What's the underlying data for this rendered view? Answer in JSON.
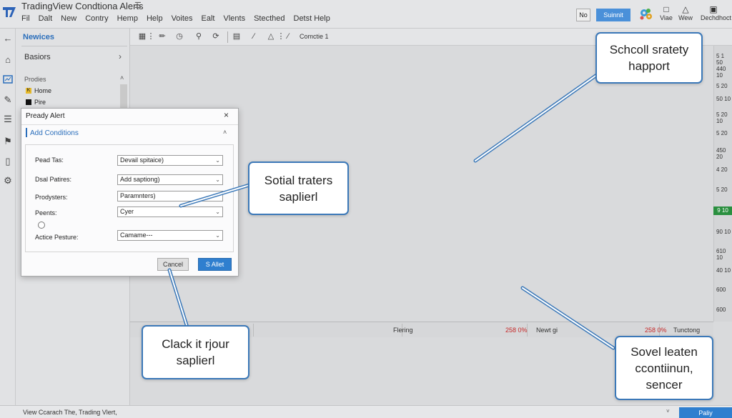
{
  "app": {
    "title": "TradingView  Condtiona Alerts",
    "title_ext": "☰",
    "menu": [
      "Fil",
      "Dalt",
      "New",
      "Contry",
      "Hemp",
      "Help",
      "Voites",
      "Ealt",
      "Vlents",
      "Stecthed",
      "Detst Help"
    ]
  },
  "top_right": {
    "no_label": "No",
    "submit_label": "Suinnit",
    "tools": [
      {
        "icon": "phone-icon",
        "label": "Viae"
      },
      {
        "icon": "bell-icon",
        "label": "Wew"
      },
      {
        "icon": "doc-icon",
        "label": "Dechdhoct"
      }
    ]
  },
  "left_toolbar": {
    "icons": [
      "back-arrow-icon",
      "home-icon",
      "chart-icon",
      "pencil-icon",
      "list-icon",
      "flag-icon",
      "page-icon",
      "settings-icon"
    ]
  },
  "panel": {
    "header": "Newices",
    "section": "Basiors",
    "arrow": "›",
    "sub": "Prodies",
    "caret": "˄",
    "items": [
      {
        "marker": "K",
        "color": "#e5b92c",
        "label": "Home"
      },
      {
        "marker": "",
        "color": "#111111",
        "label": "Pire"
      }
    ]
  },
  "chart_toolbar": {
    "label": "Comctie 1"
  },
  "price_axis": {
    "labels": [
      "5 1 50",
      "440 10",
      "5 20",
      "50 10",
      "5 20 10",
      "5 20",
      "450 20",
      "4 20",
      "5 20",
      "9 10",
      "90 10",
      "610 10",
      "40 10",
      "600"
    ],
    "highlight": "40 10",
    "highlight_color": "#2a8f3f"
  },
  "time_axis": {
    "labels": [
      {
        "text": "Flering",
        "red": false
      },
      {
        "text": "258 0%",
        "red": true
      },
      {
        "text": "Newt gi",
        "red": false
      },
      {
        "text": "258 0%",
        "red": true
      },
      {
        "text": "Tunctong",
        "red": false
      }
    ]
  },
  "status": {
    "text": "View Ccarach The, Trading Vlert,",
    "arrow": "˅",
    "button": "Paliy"
  },
  "dialog": {
    "title": "Pready Alert",
    "close": "×",
    "tab": "Add Conditions",
    "tab_caret": "˄",
    "fields": [
      {
        "label": "Pead Tas:",
        "value": "Devail spitaice)",
        "has_caret": true
      },
      {
        "label": "Dsal Patires:",
        "value": "Add saptiong)",
        "has_caret": true
      },
      {
        "label": "Prodysters:",
        "value": "Paramnters)",
        "has_caret": false
      },
      {
        "label": "Peents:",
        "value": "Cyer",
        "has_caret": true
      },
      {
        "label": "Actice Pesture:",
        "value": "Camame---",
        "has_caret": true
      }
    ],
    "cancel": "Cancel",
    "submit": "S Allet"
  },
  "callouts": [
    {
      "lines": [
        "Schcoll sratety",
        "happort"
      ]
    },
    {
      "lines": [
        "Sotial traters",
        "saplierl"
      ]
    },
    {
      "lines": [
        "Clack it rjour",
        "saplierl"
      ]
    },
    {
      "lines": [
        "Sovel leaten",
        "ccontiinun,",
        "sencer"
      ]
    }
  ],
  "colors": {
    "accent": "#2f7fcf",
    "callout_border": "#3b78b8",
    "red_text": "#c62828"
  }
}
